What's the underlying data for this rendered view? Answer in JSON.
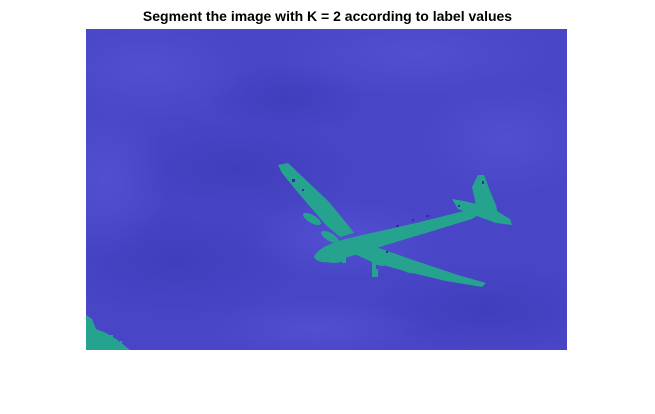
{
  "figure": {
    "title": "Segment the image with K = 2 according to label values"
  },
  "segmentation": {
    "k": 2,
    "colors": {
      "background_label": "#4a48c8",
      "object_label": "#25a38f",
      "cloud_shade_light": "#5856d4",
      "cloud_shade_dark": "#3c3bb8"
    }
  }
}
